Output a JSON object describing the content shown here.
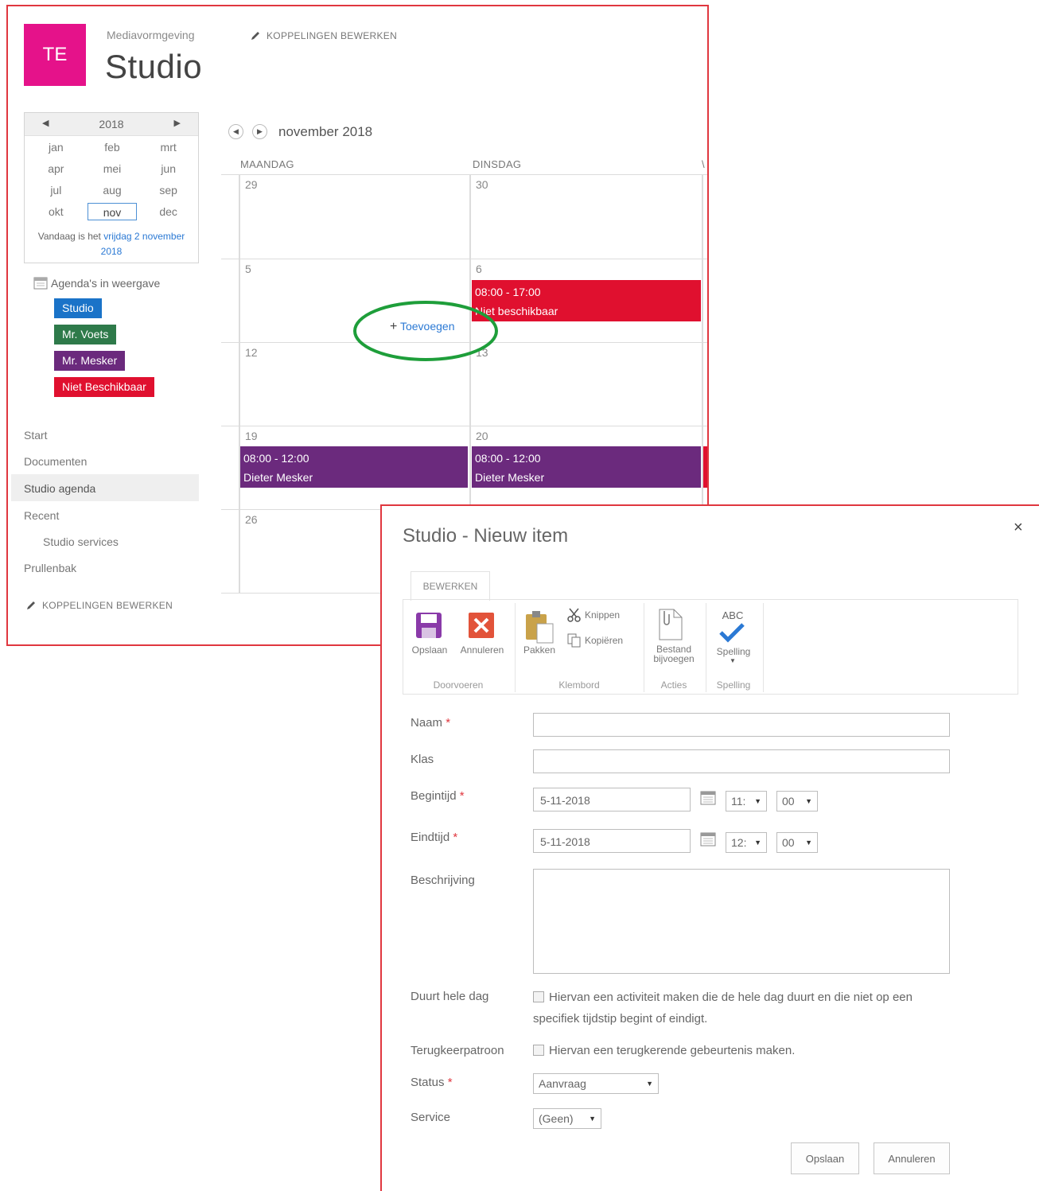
{
  "site": {
    "logo_text": "TE",
    "logo_color": "#e5128a",
    "subtitle": "Mediavormgeving",
    "title": "Studio",
    "edit_links": "KOPPELINGEN BEWERKEN"
  },
  "mini_calendar": {
    "year": "2018",
    "months": [
      "jan",
      "feb",
      "mrt",
      "apr",
      "mei",
      "jun",
      "jul",
      "aug",
      "sep",
      "okt",
      "nov",
      "dec"
    ],
    "selected_month": "nov",
    "today_prefix": "Vandaag is het",
    "today_link": "vrijdag 2 november 2018"
  },
  "calendars": {
    "title": "Agenda's in weergave",
    "items": [
      {
        "label": "Studio",
        "color": "#1a73c8"
      },
      {
        "label": "Mr. Voets",
        "color": "#2e7a4a"
      },
      {
        "label": "Mr. Mesker",
        "color": "#6b2a7d"
      },
      {
        "label": "Niet Beschikbaar",
        "color": "#e0102f"
      }
    ]
  },
  "nav": {
    "items": [
      "Start",
      "Documenten",
      "Studio agenda",
      "Recent",
      "Studio services",
      "Prullenbak"
    ],
    "edit_links": "KOPPELINGEN BEWERKEN"
  },
  "calendar": {
    "month_label": "november 2018",
    "day_headers": [
      "MAANDAG",
      "DINSDAG"
    ],
    "weeks": [
      {
        "mon": "29",
        "tue": "30"
      },
      {
        "mon": "5",
        "tue": "6"
      },
      {
        "mon": "12",
        "tue": "13"
      },
      {
        "mon": "19",
        "tue": "20"
      },
      {
        "mon": "26",
        "tue": ""
      }
    ],
    "events": {
      "tue_week2": {
        "time": "08:00 - 17:00",
        "title": "Niet beschikbaar",
        "color": "#e0102f"
      },
      "mon_week4": {
        "time": "08:00 - 12:00",
        "title": "Dieter Mesker",
        "color": "#6b2a7d"
      },
      "tue_week4": {
        "time": "08:00 - 12:00",
        "title": "Dieter Mesker",
        "color": "#6b2a7d"
      }
    },
    "add_label": "Toevoegen",
    "highlight_color": "#1e9e3a"
  },
  "dialog": {
    "title": "Studio - Nieuw item",
    "tab": "BEWERKEN",
    "ribbon": {
      "save": "Opslaan",
      "cancel": "Annuleren",
      "paste": "Pakken",
      "cut": "Knippen",
      "copy": "Kopiëren",
      "attach": "Bestand bijvoegen",
      "spelling_icon": "ABC",
      "spelling": "Spelling",
      "groups": [
        "Doorvoeren",
        "Klembord",
        "Acties",
        "Spelling"
      ]
    },
    "fields": {
      "name_label": "Naam",
      "class_label": "Klas",
      "start_label": "Begintijd",
      "end_label": "Eindtijd",
      "start_date": "5-11-2018",
      "start_hour": "11:",
      "start_min": "00",
      "end_date": "5-11-2018",
      "end_hour": "12:",
      "end_min": "00",
      "desc_label": "Beschrijving",
      "allday_label": "Duurt hele dag",
      "allday_text": "Hiervan een activiteit maken die de hele dag duurt en die niet op een specifiek tijdstip begint of eindigt.",
      "recur_label": "Terugkeerpatroon",
      "recur_text": "Hiervan een terugkerende gebeurtenis maken.",
      "status_label": "Status",
      "status_value": "Aanvraag",
      "service_label": "Service",
      "service_value": "(Geen)",
      "required_mark": "*"
    },
    "buttons": {
      "save": "Opslaan",
      "cancel": "Annuleren"
    },
    "close": "×"
  }
}
